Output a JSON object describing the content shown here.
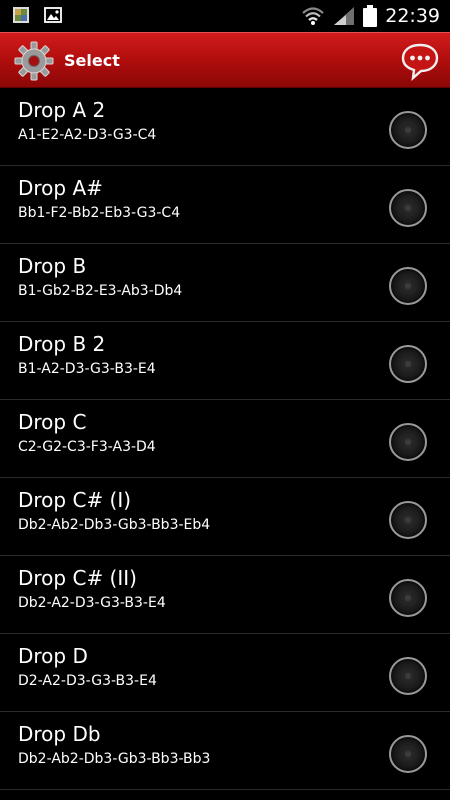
{
  "status_bar": {
    "time": "22:39",
    "icons": [
      "photo-notification-icon",
      "gallery-notification-icon",
      "wifi-icon",
      "signal-icon",
      "battery-icon"
    ]
  },
  "action_bar": {
    "title": "Select",
    "left_icon": "gear-icon",
    "right_icon": "chat-bubble-icon",
    "colors": {
      "bar": "#b10d0d",
      "text": "#ffffff"
    }
  },
  "tunings": [
    {
      "name": "Drop A 2",
      "notes": "A1-E2-A2-D3-G3-C4",
      "selected": false
    },
    {
      "name": "Drop A#",
      "notes": "Bb1-F2-Bb2-Eb3-G3-C4",
      "selected": false
    },
    {
      "name": "Drop B",
      "notes": "B1-Gb2-B2-E3-Ab3-Db4",
      "selected": false
    },
    {
      "name": "Drop B 2",
      "notes": "B1-A2-D3-G3-B3-E4",
      "selected": false
    },
    {
      "name": "Drop C",
      "notes": "C2-G2-C3-F3-A3-D4",
      "selected": false
    },
    {
      "name": "Drop C# (I)",
      "notes": "Db2-Ab2-Db3-Gb3-Bb3-Eb4",
      "selected": false
    },
    {
      "name": "Drop C# (II)",
      "notes": "Db2-A2-D3-G3-B3-E4",
      "selected": false
    },
    {
      "name": "Drop D",
      "notes": "D2-A2-D3-G3-B3-E4",
      "selected": false
    },
    {
      "name": "Drop Db",
      "notes": "Db2-Ab2-Db3-Gb3-Bb3-Bb3",
      "selected": false
    }
  ]
}
